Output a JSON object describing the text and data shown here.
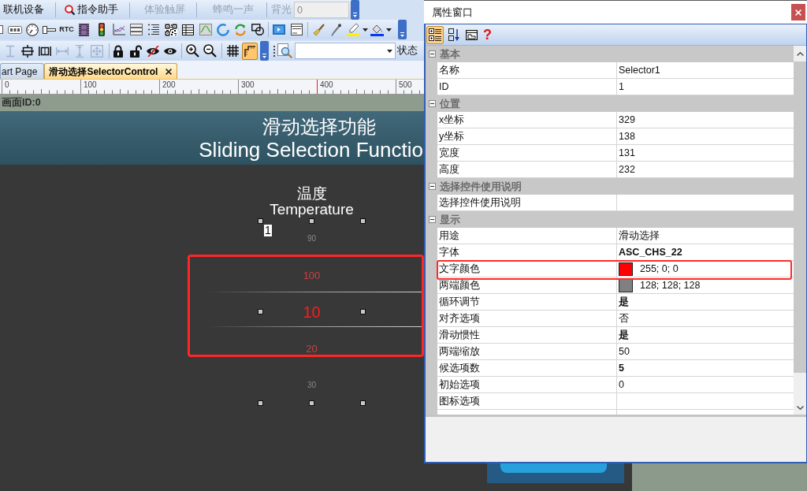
{
  "command_toolbar": {
    "buttons": [
      {
        "kind": "text",
        "label": "联机设备",
        "disabled": false
      },
      {
        "kind": "icon_text",
        "label": "指令助手",
        "disabled": false
      },
      {
        "kind": "text",
        "label": "体验触屏",
        "disabled": true
      },
      {
        "kind": "text",
        "label": "蜂鸣一声",
        "disabled": true
      }
    ],
    "backlight": {
      "label": "背光",
      "value": "0",
      "disabled": true
    }
  },
  "widget_toolbar": {
    "rtc_label": "RTC"
  },
  "layout_toolbar": {
    "buttons": [
      {
        "disabled": true
      },
      {
        "disabled": false
      },
      {
        "disabled": false
      },
      {
        "disabled": true
      },
      {
        "disabled": true
      },
      {
        "disabled": true
      }
    ],
    "snap_toggle": {
      "on": true
    },
    "status_label": "状态"
  },
  "tabs": [
    {
      "label": "art Page",
      "selected": false
    },
    {
      "label": "滑动选择SelectorControl",
      "selected": true
    }
  ],
  "ruler": {
    "ticks": [
      {
        "label": "0",
        "marked": false
      },
      {
        "label": "100",
        "marked": false
      },
      {
        "label": "200",
        "marked": false
      },
      {
        "label": "300",
        "marked": false
      },
      {
        "label": "400",
        "marked": true
      },
      {
        "label": "500",
        "marked": false
      }
    ]
  },
  "screen_bar": {
    "label": "画面ID:0"
  },
  "canvas": {
    "header": {
      "title": "滑动选择功能",
      "subtitle": "Sliding Selection Functio"
    },
    "caption": {
      "title": "温度",
      "subtitle": "Temperature"
    },
    "selector": {
      "selected": true,
      "highlighted": true,
      "id_tag": "1",
      "items": [
        {
          "label": "90",
          "selected": false
        },
        {
          "label": "100",
          "selected": false
        },
        {
          "label": "10",
          "selected": true
        },
        {
          "label": "20",
          "selected": false
        },
        {
          "label": "30",
          "selected": false
        }
      ]
    }
  },
  "property_window": {
    "title": "属性窗口",
    "toolbar": {
      "view_buttons": [
        {
          "selected": true
        },
        {
          "selected": false
        }
      ],
      "help_label": "?"
    },
    "categories": [
      {
        "name": "基本",
        "expanded": true,
        "rows": [
          {
            "name": "名称",
            "value": "Selector1",
            "modified": false,
            "highlighted": false
          },
          {
            "name": "ID",
            "value": "1",
            "modified": false,
            "highlighted": false
          }
        ]
      },
      {
        "name": "位置",
        "expanded": true,
        "rows": [
          {
            "name": "x坐标",
            "value": "329",
            "modified": false,
            "highlighted": false
          },
          {
            "name": "y坐标",
            "value": "138",
            "modified": false,
            "highlighted": false
          },
          {
            "name": "宽度",
            "value": "131",
            "modified": false,
            "highlighted": false
          },
          {
            "name": "高度",
            "value": "232",
            "modified": false,
            "highlighted": false
          }
        ]
      },
      {
        "name": "选择控件使用说明",
        "expanded": true,
        "rows": [
          {
            "name": "选择控件使用说明",
            "modified": false,
            "highlighted": false
          }
        ]
      },
      {
        "name": "显示",
        "expanded": true,
        "rows": [
          {
            "name": "用途",
            "value": "滑动选择",
            "modified": false,
            "highlighted": false
          },
          {
            "name": "字体",
            "value": "ASC_CHS_22",
            "modified": true,
            "highlighted": false
          },
          {
            "name": "文字颜色",
            "value": "255; 0; 0",
            "color": "#ff0000",
            "modified": false,
            "highlighted": true
          },
          {
            "name": "两端颜色",
            "value": "128; 128; 128",
            "color": "#808080",
            "modified": false,
            "highlighted": false
          },
          {
            "name": "循环调节",
            "value": "是",
            "modified": true,
            "highlighted": false
          },
          {
            "name": "对齐选项",
            "value": "否",
            "modified": false,
            "highlighted": false
          },
          {
            "name": "滑动惯性",
            "value": "是",
            "modified": true,
            "highlighted": false
          },
          {
            "name": "两端缩放",
            "value": "50",
            "modified": false,
            "highlighted": false
          },
          {
            "name": "候选项数",
            "value": "5",
            "modified": true,
            "highlighted": false
          },
          {
            "name": "初始选项",
            "value": "0",
            "modified": false,
            "highlighted": false
          },
          {
            "name": "图标选项",
            "modified": false,
            "highlighted": false
          }
        ]
      }
    ]
  }
}
